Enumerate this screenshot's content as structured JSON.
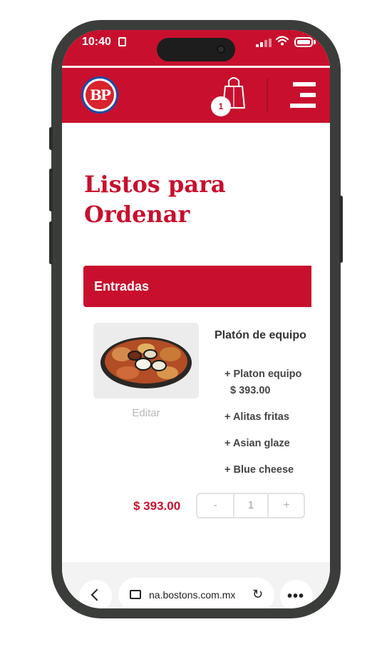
{
  "status_bar": {
    "time": "10:40"
  },
  "header": {
    "logo_text": "BP",
    "cart_count": "1"
  },
  "page": {
    "title": "Listos para Ordenar"
  },
  "category": {
    "label": "Entradas"
  },
  "product": {
    "name": "Platón de equipo",
    "edit_label": "Editar",
    "options": [
      {
        "label": "+ Platon equipo",
        "price": "$ 393.00"
      },
      {
        "label": "+ Alitas fritas"
      },
      {
        "label": "+ Asian glaze"
      },
      {
        "label": "+ Blue cheese"
      }
    ],
    "total": "$ 393.00",
    "quantity": {
      "minus": "-",
      "value": "1",
      "plus": "+"
    }
  },
  "browser": {
    "url": "na.bostons.com.mx",
    "more": "•••"
  },
  "colors": {
    "brand_red": "#c8102e",
    "phone_frame": "#3a3d3a"
  }
}
